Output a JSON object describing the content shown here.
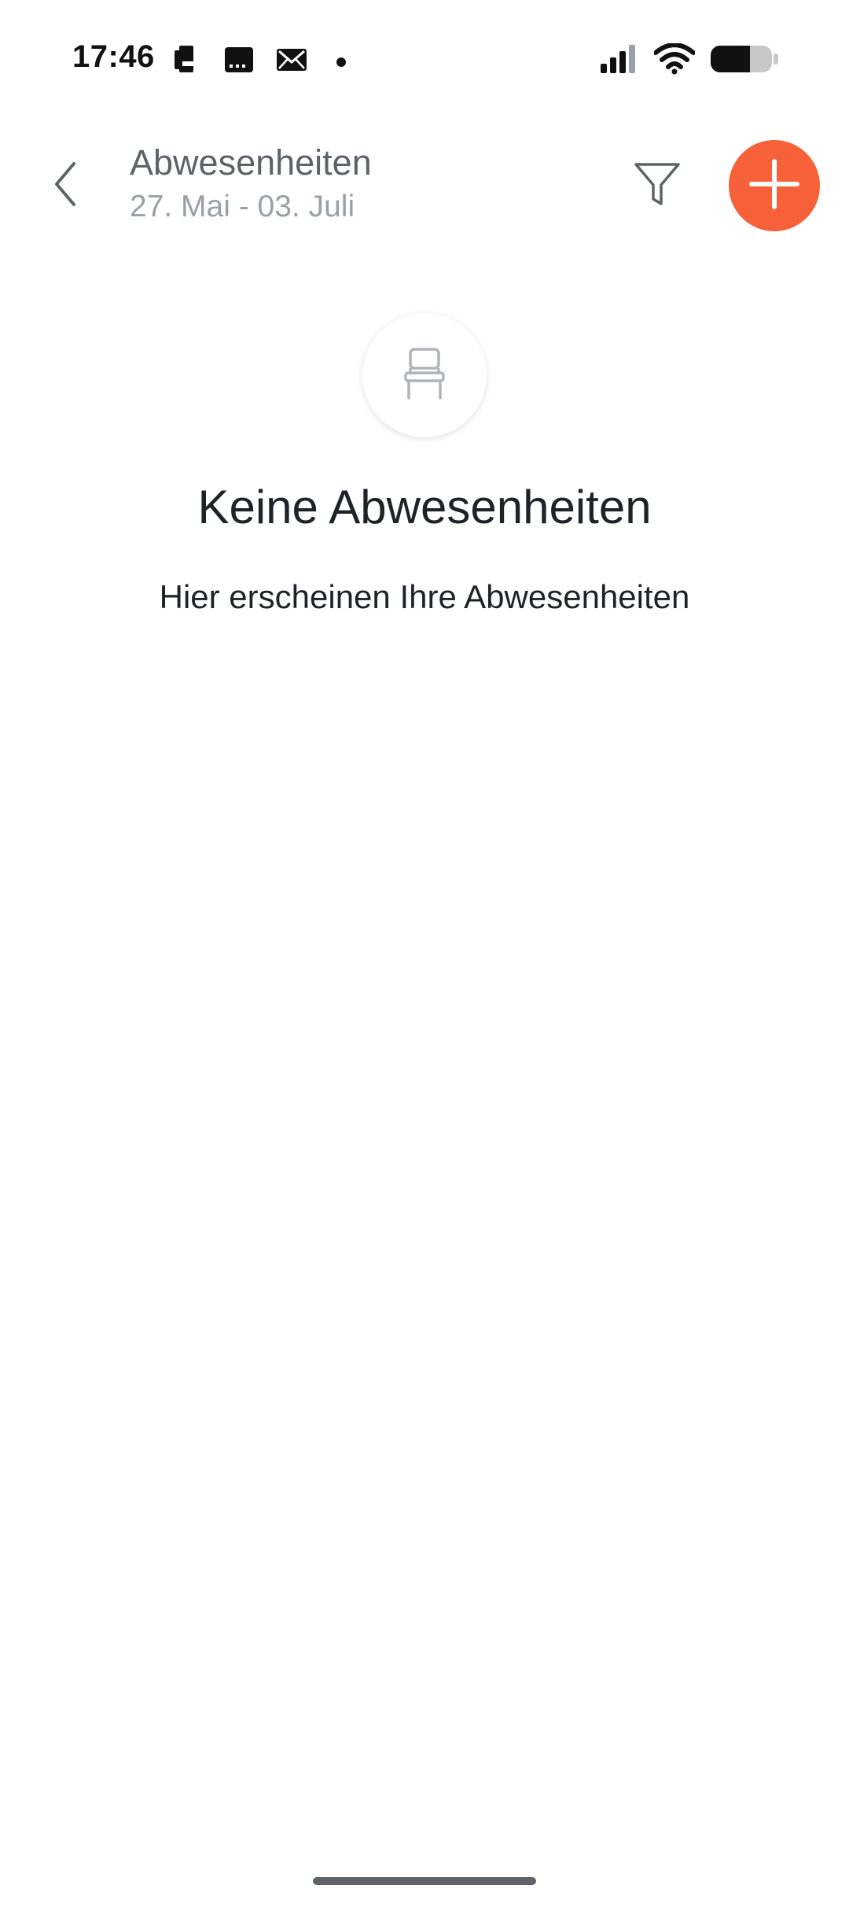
{
  "status_bar": {
    "time": "17:46",
    "left_icons": [
      "phone-icon",
      "calendar-icon",
      "mail-icon",
      "notification-dot-icon"
    ],
    "right_icons": [
      "signal-icon",
      "wifi-icon",
      "battery-icon"
    ]
  },
  "header": {
    "title": "Abwesenheiten",
    "subtitle": "27. Mai - 03. Juli",
    "back_icon": "chevron-left-icon",
    "filter_icon": "filter-icon",
    "add_icon": "plus-icon"
  },
  "empty_state": {
    "icon": "chair-icon",
    "title": "Keine Abwesenheiten",
    "message": "Hier erscheinen Ihre Abwesenheiten"
  },
  "colors": {
    "accent": "#f6613a",
    "title_gray": "#5f6368",
    "subtitle_gray": "#9aa0a6",
    "text_dark": "#1f2328"
  }
}
